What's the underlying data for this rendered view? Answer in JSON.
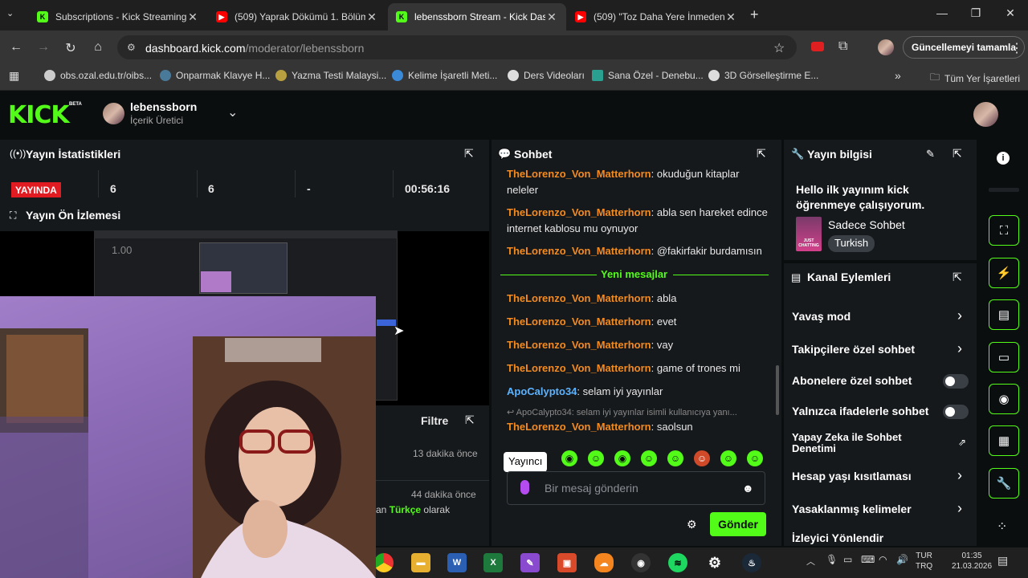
{
  "browser": {
    "tabs": [
      {
        "title": "Subscriptions - Kick Streaming",
        "icon": "kick-icon"
      },
      {
        "title": "(509) Yaprak Dökümü 1. Bölüm",
        "icon": "youtube-icon"
      },
      {
        "title": "lebenssborn Stream - Kick Dash",
        "icon": "kick-icon"
      },
      {
        "title": "(509) \"Toz Daha Yere İnmeden",
        "icon": "youtube-icon"
      }
    ],
    "url_host": "dashboard.kick.com",
    "url_path": "/moderator/lebenssborn",
    "update_label": "Güncellemeyi tamamla",
    "bookmarks": [
      "obs.ozal.edu.tr/oibs...",
      "Onparmak Klavye H...",
      "Yazma Testi Malaysi...",
      "Kelime İşaretli Meti...",
      "Ders Videoları",
      "Sana Özel - Denebu...",
      "3D Görselleştirme E..."
    ],
    "all_bookmarks": "Tüm Yer İşaretleri"
  },
  "kick": {
    "logo": "KICK",
    "beta": "BETA",
    "channel_name": "lebenssborn",
    "channel_role": "İçerik Üretici"
  },
  "stats": {
    "title": "Yayın İstatistikleri",
    "live_badge": "YAYINDA",
    "viewers": "6",
    "followers": "6",
    "dash": "-",
    "duration": "00:56:16"
  },
  "preview": {
    "title": "Yayın Ön İzlemesi",
    "zoom": "1.00"
  },
  "activity": {
    "filter_label": "Filtre",
    "items": [
      {
        "time": "13 dakika önce"
      },
      {
        "time": "44 dakika önce",
        "text_pre": "an",
        "lang": "Türkçe",
        "text_post": "olarak"
      }
    ]
  },
  "chat": {
    "title": "Sohbet",
    "messages": [
      {
        "user": "TheLorenzo_Von_Matterhorn",
        "text": "okuduğun kitaplar neleler"
      },
      {
        "user": "TheLorenzo_Von_Matterhorn",
        "text": "abla sen hareket edince internet kablosu mu oynuyor"
      },
      {
        "user": "TheLorenzo_Von_Matterhorn",
        "text": "@fakirfakir burdamısın"
      }
    ],
    "new_messages_label": "Yeni mesajlar",
    "new_messages": [
      {
        "user": "TheLorenzo_Von_Matterhorn",
        "text": "abla"
      },
      {
        "user": "TheLorenzo_Von_Matterhorn",
        "text": "evet"
      },
      {
        "user": "TheLorenzo_Von_Matterhorn",
        "text": "vay"
      },
      {
        "user": "TheLorenzo_Von_Matterhorn",
        "text": "game of trones mi"
      },
      {
        "user": "ApoCalypto34",
        "text": "selam iyi yayınlar"
      }
    ],
    "reply_context": "ApoCalypto34: selam iyi yayınlar isimli kullanıcıya yanı...",
    "reply": {
      "user": "TheLorenzo_Von_Matterhorn",
      "text": "saolsun"
    },
    "tooltip": "Yayıncı",
    "input_placeholder": "Bir mesaj gönderin",
    "send_label": "Gönder"
  },
  "info": {
    "title": "Yayın bilgisi",
    "stream_title": "Hello ilk yayınım kick öğrenmeye çalışıyorum.",
    "category": "Sadece Sohbet",
    "language_tag": "Turkish",
    "thumb_text": "JUST CHATTING"
  },
  "actions": {
    "title": "Kanal Eylemleri",
    "items": [
      {
        "label": "Yavaş mod",
        "control": "chevron"
      },
      {
        "label": "Takipçilere özel sohbet",
        "control": "chevron"
      },
      {
        "label": "Abonelere özel sohbet",
        "control": "toggle",
        "on": false
      },
      {
        "label": "Yalnızca ifadelerle sohbet",
        "control": "toggle",
        "on": false
      },
      {
        "label": "Yapay Zeka ile Sohbet Denetimi",
        "control": "external"
      },
      {
        "label": "Hesap yaşı kısıtlaması",
        "control": "chevron"
      },
      {
        "label": "Yasaklanmış kelimeler",
        "control": "chevron"
      },
      {
        "label": "İzleyici Yönlendir",
        "control": "none"
      }
    ]
  },
  "taskbar": {
    "lang_top": "TUR",
    "lang_bottom": "TRQ",
    "time": "01:35",
    "date": "21.03.2026"
  },
  "colors": {
    "kick_green": "#53fc18",
    "username_orange": "#f58a1f",
    "username_blue": "#5bb3ff",
    "live_red": "#e11b22"
  }
}
